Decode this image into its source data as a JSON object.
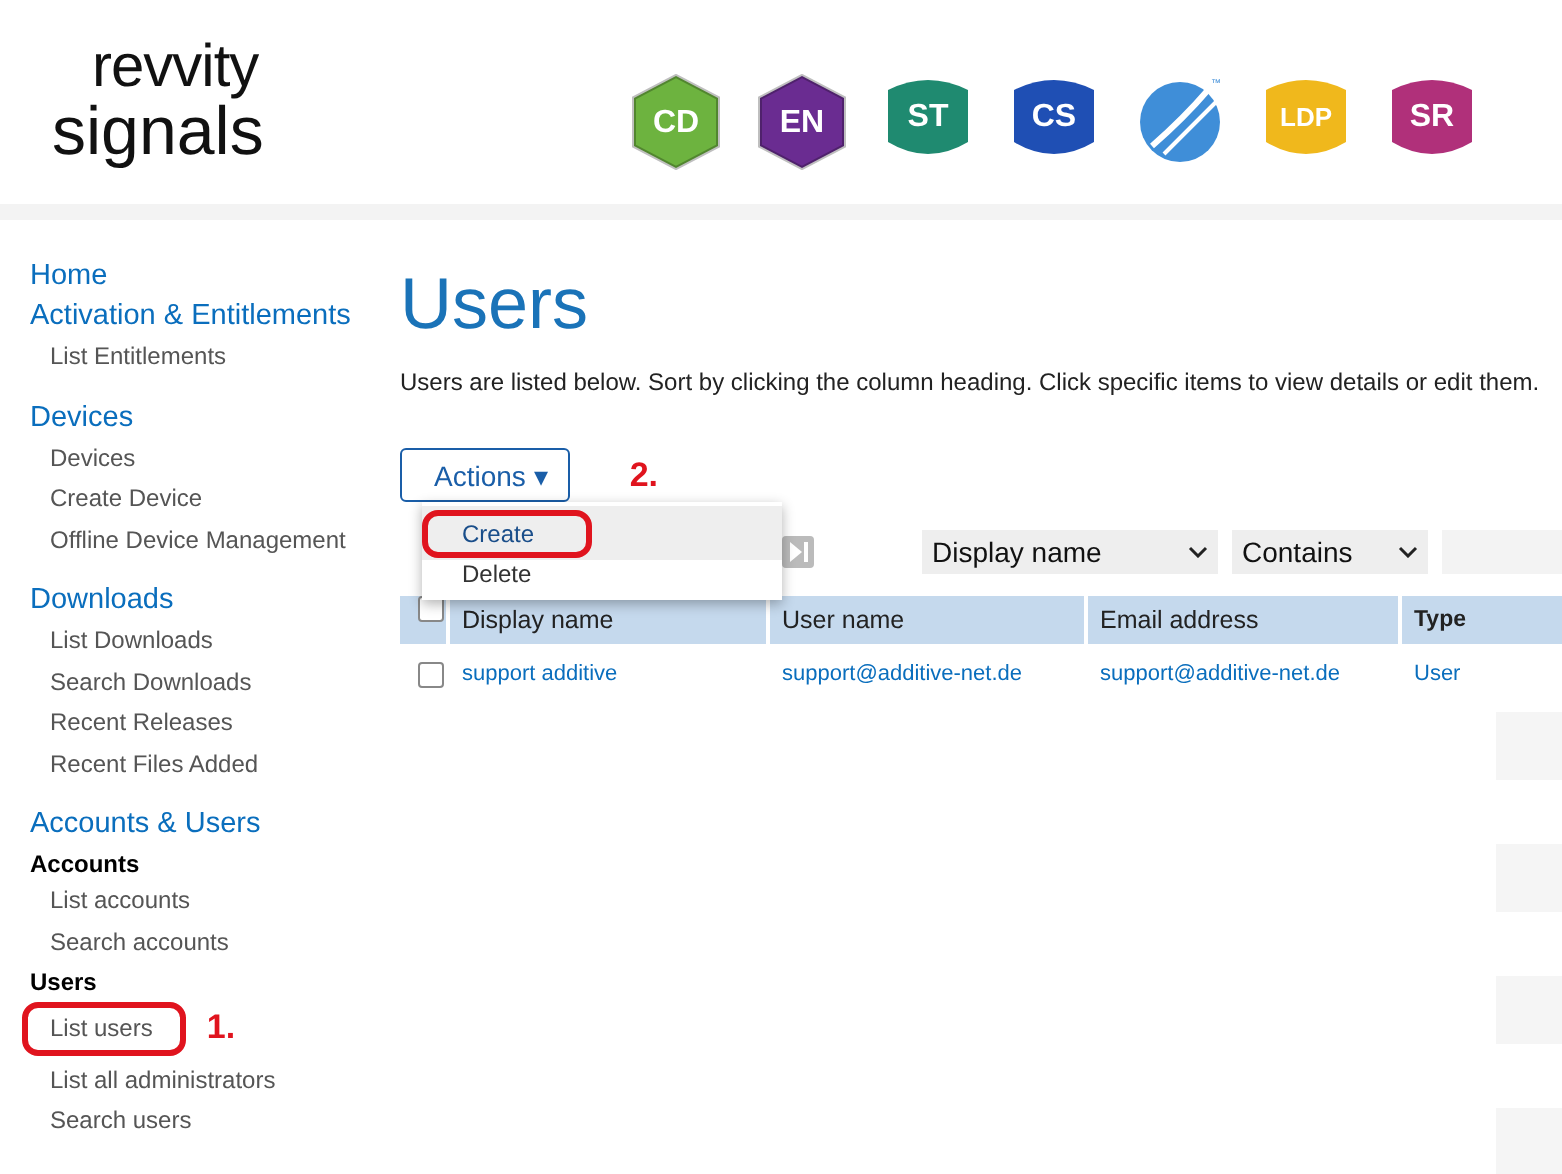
{
  "header": {
    "logo": {
      "line1": "revvity",
      "line2": "signals"
    },
    "apps": [
      {
        "label": "CD",
        "kind": "hexagon",
        "color": "#6db33f"
      },
      {
        "label": "EN",
        "kind": "hexagon",
        "color": "#6a2c91"
      },
      {
        "label": "ST",
        "kind": "shield",
        "color": "#1f8a70"
      },
      {
        "label": "CS",
        "kind": "shield",
        "color": "#1f4fb4"
      },
      {
        "label": "™",
        "kind": "circle",
        "color": "#3f8ed8"
      },
      {
        "label": "LDP",
        "kind": "shield",
        "color": "#f0b81c"
      },
      {
        "label": "SR",
        "kind": "shield",
        "color": "#b0307a"
      }
    ]
  },
  "sidebar": {
    "sections": [
      {
        "title": "Home"
      },
      {
        "title": "Activation & Entitlements",
        "items": [
          {
            "label": "List Entitlements",
            "kind": "link",
            "circled": false
          }
        ]
      },
      {
        "title": "Devices",
        "items": [
          {
            "label": "Devices",
            "kind": "link",
            "circled": false
          },
          {
            "label": "Create Device",
            "kind": "link",
            "circled": false
          },
          {
            "label": "Offline Device Management",
            "kind": "link",
            "circled": false
          }
        ]
      },
      {
        "title": "Downloads",
        "items": [
          {
            "label": "List Downloads",
            "kind": "link",
            "circled": false
          },
          {
            "label": "Search Downloads",
            "kind": "link",
            "circled": false
          },
          {
            "label": "Recent Releases",
            "kind": "link",
            "circled": false
          },
          {
            "label": "Recent Files Added",
            "kind": "link",
            "circled": false
          }
        ]
      },
      {
        "title": "Accounts & Users",
        "items": [
          {
            "label": "Accounts",
            "kind": "subheading"
          },
          {
            "label": "List accounts",
            "kind": "link",
            "circled": false
          },
          {
            "label": "Search accounts",
            "kind": "link",
            "circled": false
          },
          {
            "label": "Users",
            "kind": "subheading"
          },
          {
            "label": "List users",
            "kind": "link",
            "circled": true,
            "annotation": "1."
          },
          {
            "label": "List all administrators",
            "kind": "link",
            "circled": false
          },
          {
            "label": "Search users",
            "kind": "link",
            "circled": false
          }
        ]
      }
    ]
  },
  "main": {
    "title": "Users",
    "description": "Users are listed below. Sort by clicking the column heading. Click specific items to view details or edit them.",
    "actions": {
      "label": "Actions ▾",
      "annotation": "2.",
      "items": [
        {
          "label": "Create",
          "selected": true,
          "circled": true
        },
        {
          "label": "Delete",
          "selected": false,
          "circled": false
        }
      ]
    },
    "filter": {
      "field": "Display name",
      "operator": "Contains"
    },
    "table": {
      "select_all_checked": false,
      "columns": [
        "Display name",
        "User name",
        "Email address",
        "Type"
      ],
      "rows": [
        {
          "checked": false,
          "cells": [
            "support additive",
            "support@additive-net.de",
            "support@additive-net.de",
            "User"
          ]
        }
      ]
    }
  }
}
